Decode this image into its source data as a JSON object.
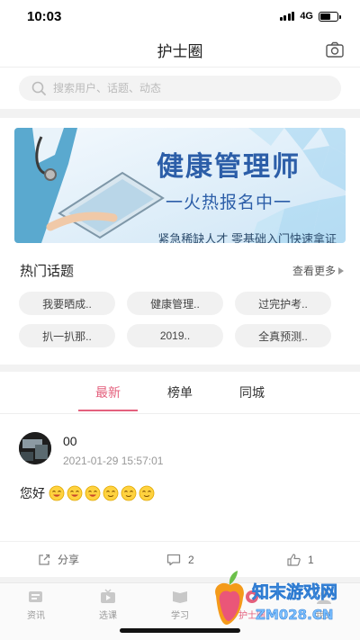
{
  "status_bar": {
    "time": "10:03",
    "network": "4G",
    "battery_level": 0.6
  },
  "nav": {
    "title": "护士圈",
    "camera_icon": "camera-icon"
  },
  "search": {
    "placeholder": "搜索用户、话题、动态",
    "value": "",
    "icon": "search-icon"
  },
  "banner": {
    "title": "健康管理师",
    "subtitle": "一火热报名中一",
    "description": "紧急稀缺人才  零基础入门快速拿证",
    "colors": {
      "background": "#e6f1fa",
      "accent": "#2c5ea8"
    }
  },
  "hot_topics": {
    "title": "热门话题",
    "see_more": "查看更多",
    "items": [
      {
        "label": "我要晒成.."
      },
      {
        "label": "健康管理.."
      },
      {
        "label": "过完护考.."
      },
      {
        "label": "扒一扒那.."
      },
      {
        "label": "2019.."
      },
      {
        "label": "全真预测.."
      }
    ]
  },
  "feed_tabs": {
    "items": [
      {
        "label": "最新",
        "active": true
      },
      {
        "label": "榜单",
        "active": false
      },
      {
        "label": "同城",
        "active": false
      }
    ],
    "accent": "#e4607d"
  },
  "post": {
    "username": "00",
    "timestamp": "2021-01-29 15:57:01",
    "text": "您好",
    "emojis": [
      "grin-emoji",
      "grin-emoji",
      "grin-emoji",
      "smile-emoji",
      "smile-emoji",
      "smile-emoji"
    ],
    "share_label": "分享",
    "comment_count": "2",
    "like_count": "1"
  },
  "tabbar": {
    "items": [
      {
        "label": "资讯",
        "icon": "news-icon",
        "active": false
      },
      {
        "label": "选课",
        "icon": "video-icon",
        "active": false
      },
      {
        "label": "学习",
        "icon": "book-icon",
        "active": false
      },
      {
        "label": "护士圈",
        "icon": "circle-icon",
        "active": true
      },
      {
        "label": "我的",
        "icon": "user-icon",
        "active": false
      }
    ]
  },
  "watermark": {
    "line1": "知末游戏网",
    "line2": "ZM028.CN"
  }
}
